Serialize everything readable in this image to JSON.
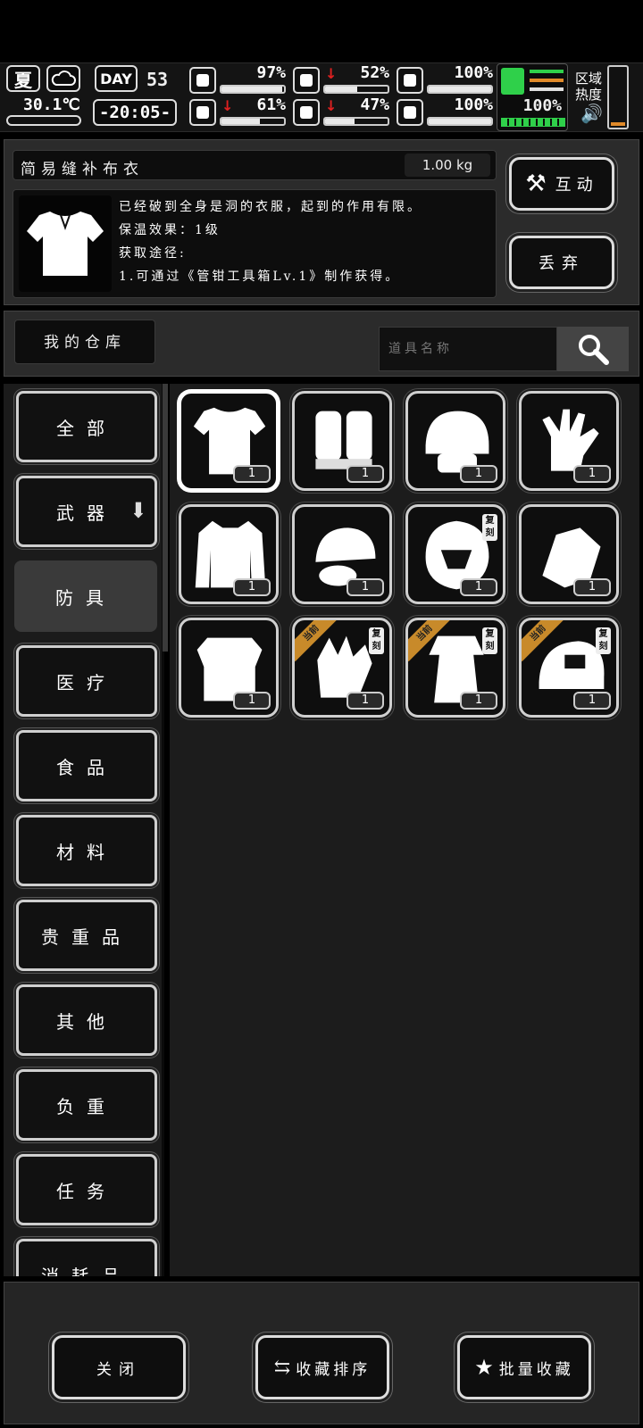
{
  "status": {
    "season": "夏",
    "temperature": "30.1℃",
    "day_label": "DAY",
    "day_number": "53",
    "clock": "-20:05-",
    "stats": [
      {
        "icon": "medkit-icon",
        "value": "97%",
        "fill": 0.97,
        "arrow": false
      },
      {
        "icon": "stomach-icon",
        "value": "52%",
        "fill": 0.52,
        "arrow": true
      },
      {
        "icon": "bandage-icon",
        "value": "100%",
        "fill": 1.0,
        "arrow": false
      },
      {
        "icon": "brain-icon",
        "value": "61%",
        "fill": 0.61,
        "arrow": true
      },
      {
        "icon": "water-drop-icon",
        "value": "47%",
        "fill": 0.47,
        "arrow": true
      },
      {
        "icon": "heart-icon",
        "value": "100%",
        "fill": 1.0,
        "arrow": false
      }
    ],
    "stamina": {
      "value": "100%",
      "fill": 1.0
    },
    "zone_heat_label_1": "区域",
    "zone_heat_label_2": "热度"
  },
  "item": {
    "name": "简易缝补布衣",
    "weight": "1.00 kg",
    "desc_lines": [
      "已经破到全身是洞的衣服，起到的作用有限。",
      "保温效果：1级",
      "获取途径:",
      "1.可通过《管钳工具箱Lv.1》制作获得。"
    ],
    "interact_label": "互动",
    "discard_label": "丢弃"
  },
  "storage": {
    "title": "我的仓库",
    "search_placeholder": "道具名称"
  },
  "categories": [
    "全部",
    "武器",
    "防具",
    "医疗",
    "食品",
    "材料",
    "贵重品",
    "其他",
    "负重",
    "任务",
    "消耗品"
  ],
  "active_category": "防具",
  "slots": [
    {
      "name": "shirt",
      "qty": "1",
      "current": false,
      "replica": false
    },
    {
      "name": "fingerless-gloves",
      "qty": "1",
      "current": false,
      "replica": false
    },
    {
      "name": "tactical-helmet",
      "qty": "1",
      "current": false,
      "replica": false
    },
    {
      "name": "glove",
      "qty": "1",
      "current": false,
      "replica": false
    },
    {
      "name": "jacket",
      "qty": "1",
      "current": false,
      "replica": false
    },
    {
      "name": "cap-with-goggles",
      "qty": "1",
      "current": false,
      "replica": false
    },
    {
      "name": "ornate-helmet",
      "qty": "1",
      "current": false,
      "replica": true
    },
    {
      "name": "armored-gloves",
      "qty": "1",
      "current": false,
      "replica": false
    },
    {
      "name": "body-armor",
      "qty": "1",
      "current": false,
      "replica": false
    },
    {
      "name": "scaled-gloves",
      "qty": "1",
      "current": true,
      "replica": true
    },
    {
      "name": "robe",
      "qty": "1",
      "current": true,
      "replica": true
    },
    {
      "name": "baseball-cap",
      "qty": "1",
      "current": true,
      "replica": true
    }
  ],
  "tags": {
    "current": "当前",
    "replica": "复刻"
  },
  "bottom": {
    "close_label": "关闭",
    "sort_label": "收藏排序",
    "batch_label": "批量收藏"
  }
}
